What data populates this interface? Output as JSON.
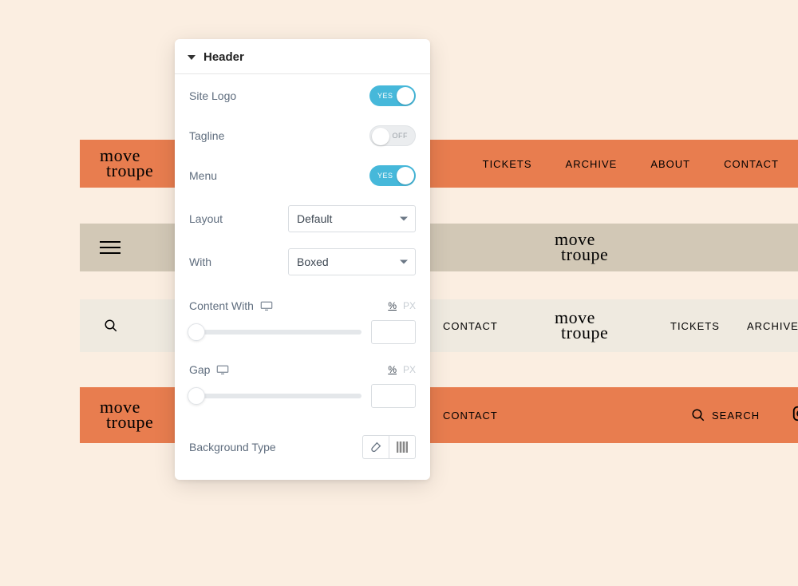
{
  "brand": {
    "line1": "move",
    "line2": "troupe"
  },
  "nav": {
    "tickets": "TICKETS",
    "archive": "ARCHIVE",
    "about": "ABOUT",
    "contact": "CONTACT",
    "search": "SEARCH"
  },
  "panel": {
    "title": "Header",
    "fields": {
      "site_logo": {
        "label": "Site Logo",
        "value": true,
        "text": "YES"
      },
      "tagline": {
        "label": "Tagline",
        "value": false,
        "text": "OFF"
      },
      "menu": {
        "label": "Menu",
        "value": true,
        "text": "YES"
      },
      "layout": {
        "label": "Layout",
        "selected": "Default"
      },
      "width": {
        "label": "With",
        "selected": "Boxed"
      },
      "content_width": {
        "label": "Content With",
        "unit_pct": "%",
        "unit_px": "PX",
        "value": ""
      },
      "gap": {
        "label": "Gap",
        "unit_pct": "%",
        "unit_px": "PX",
        "value": ""
      },
      "background_type": {
        "label": "Background Type"
      }
    }
  },
  "colors": {
    "accent_orange": "#e87d4f",
    "tan": "#d2c8b6",
    "cream": "#efeae0",
    "toggle_on": "#46b8da"
  }
}
